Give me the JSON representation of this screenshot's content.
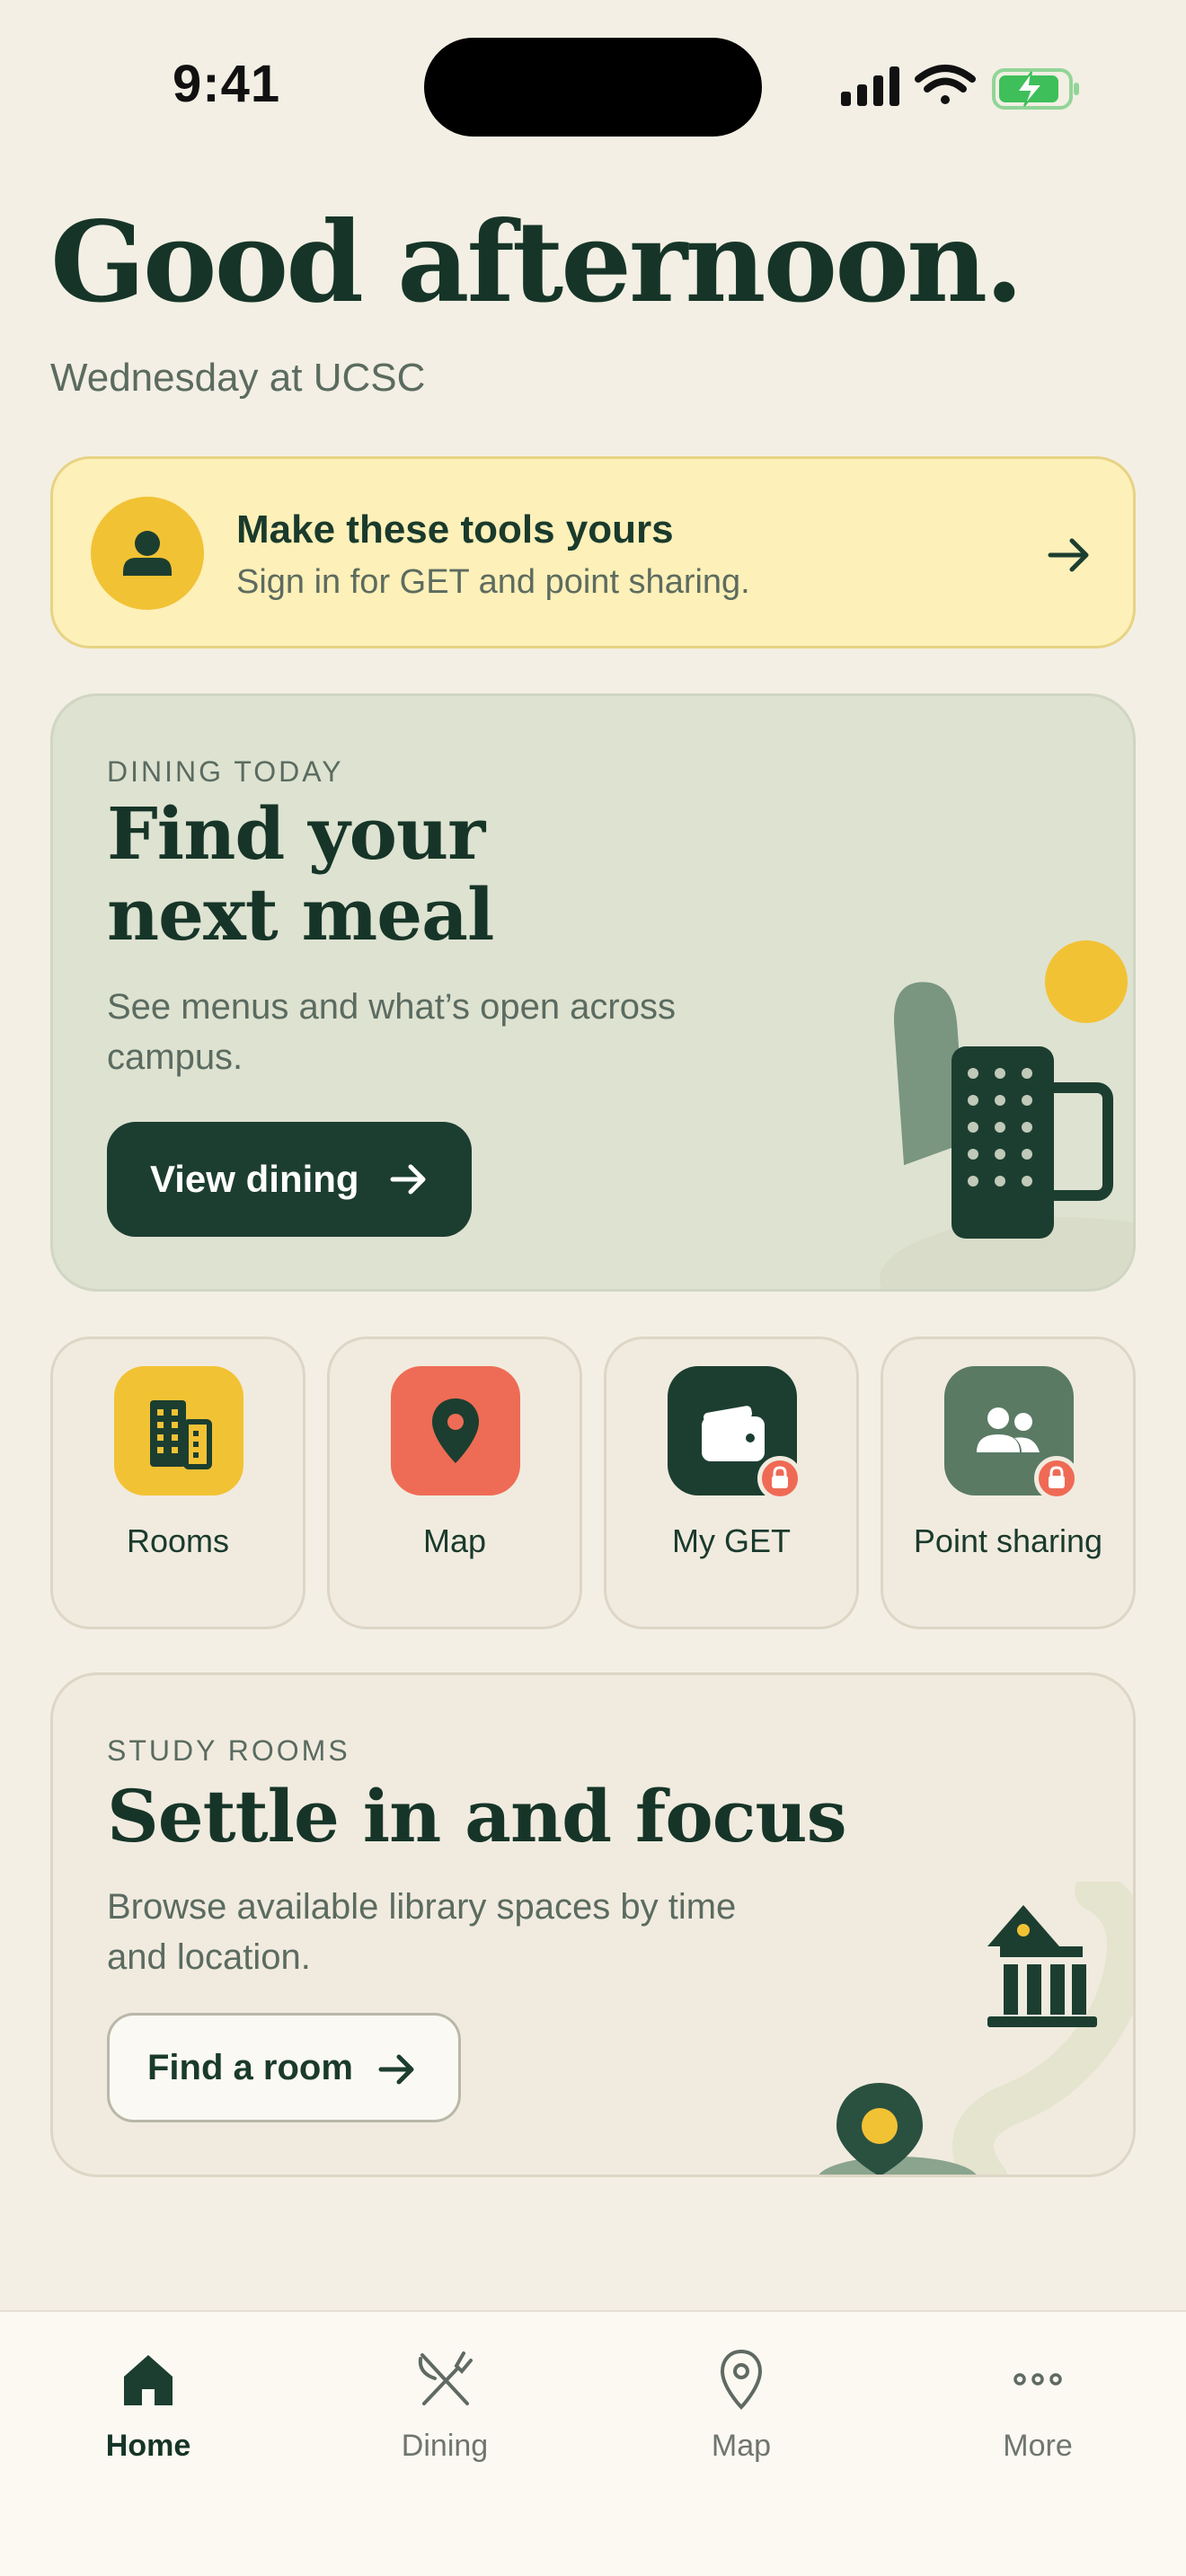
{
  "status_bar": {
    "time": "9:41",
    "battery_color": "#3fbf5a"
  },
  "greeting": {
    "title": "Good afternoon.",
    "subtitle": "Wednesday at UCSC"
  },
  "signin_banner": {
    "title": "Make these tools yours",
    "subtitle": "Sign in for GET and point sharing."
  },
  "dining_card": {
    "eyebrow": "DINING TODAY",
    "title": "Find your next meal",
    "description": "See menus and what’s open across campus.",
    "button_label": "View dining"
  },
  "tiles": [
    {
      "label": "Rooms",
      "icon": "building-icon",
      "color": "#f2c235",
      "locked": false
    },
    {
      "label": "Map",
      "icon": "map-pin-icon",
      "color": "#ee6c55",
      "locked": false
    },
    {
      "label": "My GET",
      "icon": "wallet-icon",
      "color": "#1c3e30",
      "locked": true
    },
    {
      "label": "Point sharing",
      "icon": "people-icon",
      "color": "#5a7a64",
      "locked": true
    }
  ],
  "study_card": {
    "eyebrow": "STUDY ROOMS",
    "title": "Settle in and focus",
    "description": "Browse available library spaces by time and location.",
    "button_label": "Find a room"
  },
  "tabbar": {
    "items": [
      {
        "label": "Home",
        "icon": "home-icon",
        "active": true
      },
      {
        "label": "Dining",
        "icon": "fork-knife-icon",
        "active": false
      },
      {
        "label": "Map",
        "icon": "map-pin-icon",
        "active": false
      },
      {
        "label": "More",
        "icon": "more-dots-icon",
        "active": false
      }
    ]
  },
  "colors": {
    "background": "#f3efe4",
    "primary": "#1c3e30",
    "accent_yellow": "#f2c235",
    "accent_coral": "#ee6c55",
    "banner": "#fdf0b8"
  }
}
